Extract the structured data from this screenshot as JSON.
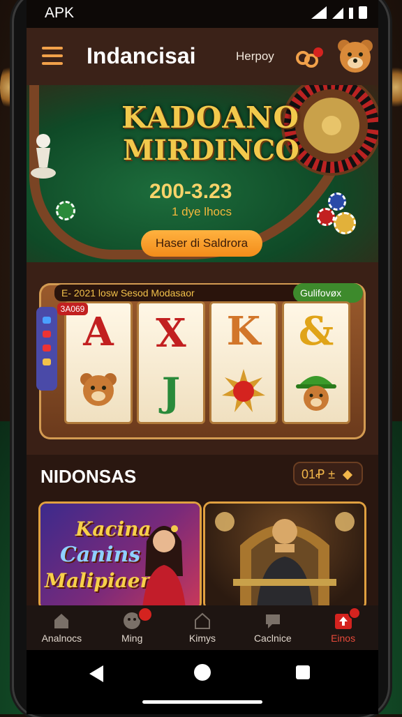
{
  "status_bar": {
    "left_text": "APK"
  },
  "app_bar": {
    "title": "Indancisai",
    "subtitle": "Herpoy"
  },
  "banner": {
    "title_line1": "KADOANO",
    "title_line2": "MIRDINCO",
    "date": "200-3.23",
    "subtitle": "1 dye lhocs",
    "cta_label": "Haser di Saldrora"
  },
  "slot": {
    "header_text": "E- 2021 losw Sesod Modasaor",
    "header_right_label": "Gulifovøx",
    "badge": "3A069",
    "reels": [
      {
        "top": "A"
      },
      {
        "top": "X",
        "bottom": "J"
      },
      {
        "top": "K"
      },
      {
        "top": "&"
      }
    ]
  },
  "section": {
    "title": "NIDONSAS",
    "control_text": "01Ꝓ ±"
  },
  "cards": [
    {
      "line1": "Kacina",
      "line2": "Canins",
      "line3": "Malipiaem"
    },
    {}
  ],
  "tabs": [
    {
      "label": "Analnocs",
      "icon": "home-icon"
    },
    {
      "label": "Ming",
      "icon": "face-icon"
    },
    {
      "label": "Kimys",
      "icon": "house-outline-icon"
    },
    {
      "label": "Caclnice",
      "icon": "chat-icon"
    },
    {
      "label": "Einos",
      "icon": "upload-icon"
    }
  ],
  "colors": {
    "accent": "#f28c1a",
    "active_tab": "#d4231f",
    "gold": "#f2c94c"
  }
}
